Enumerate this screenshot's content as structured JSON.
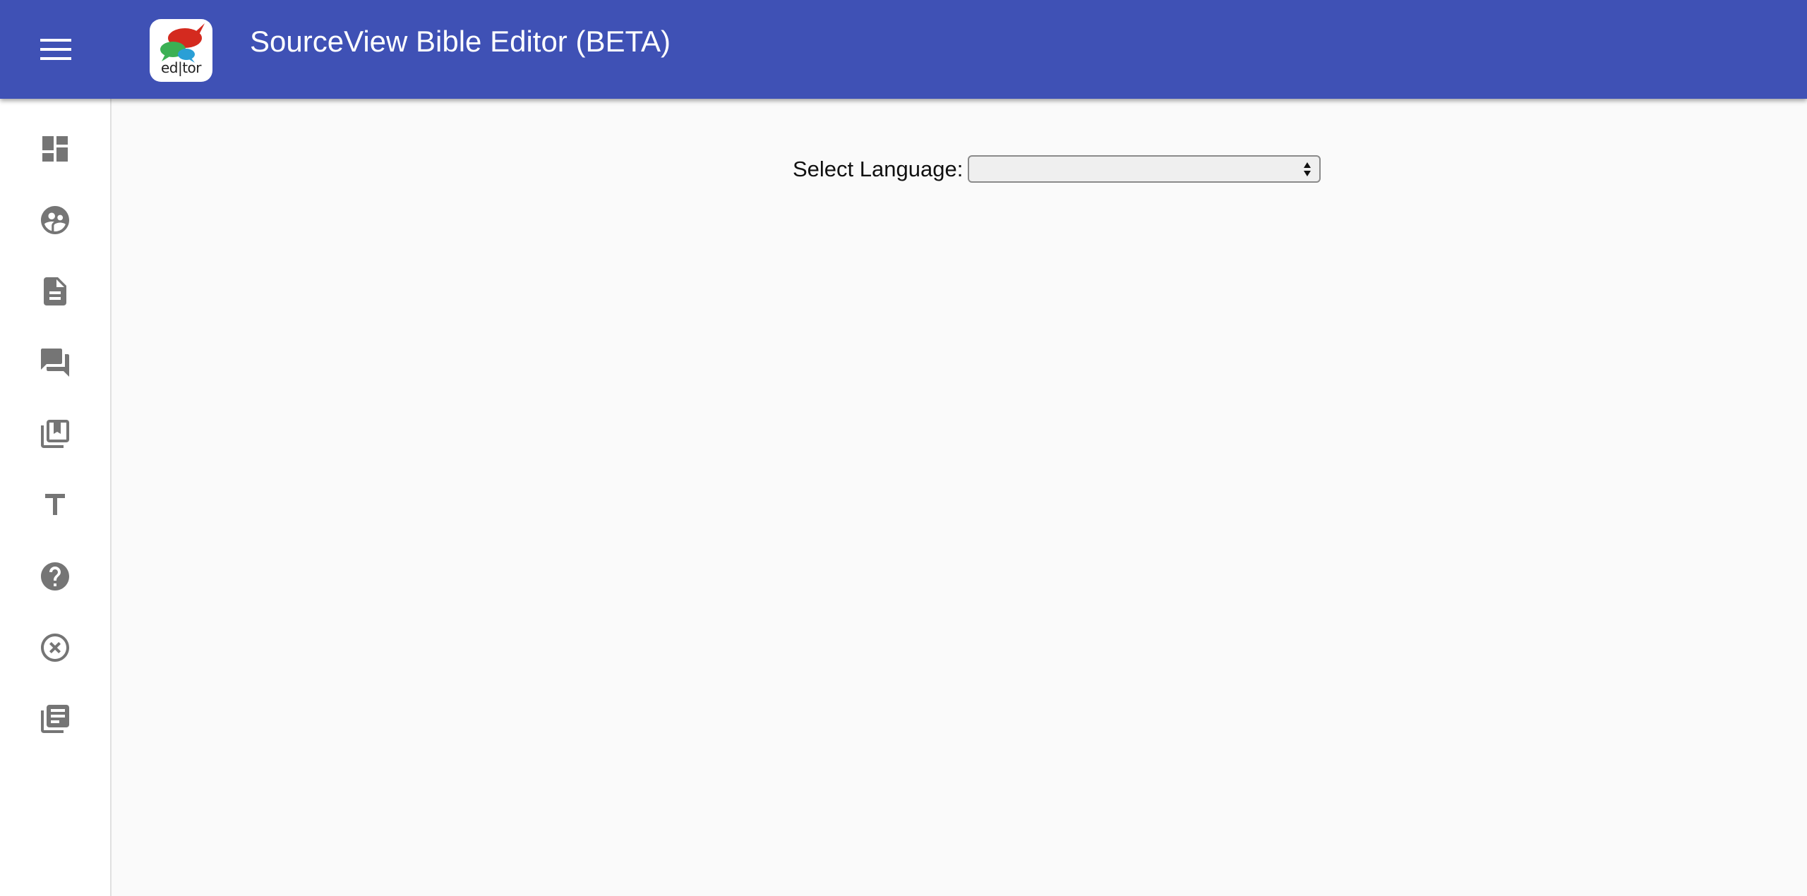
{
  "header": {
    "title": "SourceView Bible Editor (BETA)",
    "logo_text": "ed|tor",
    "background_color": "#3f51b5"
  },
  "sidebar": {
    "items": [
      {
        "icon": "dashboard-icon"
      },
      {
        "icon": "group-icon"
      },
      {
        "icon": "description-icon"
      },
      {
        "icon": "forum-icon"
      },
      {
        "icon": "library-books-bookmark-icon"
      },
      {
        "icon": "text-format-icon"
      },
      {
        "icon": "help-icon"
      },
      {
        "icon": "cancel-icon"
      },
      {
        "icon": "library-books-icon"
      }
    ]
  },
  "main": {
    "language_label": "Select Language:",
    "language_value": ""
  }
}
